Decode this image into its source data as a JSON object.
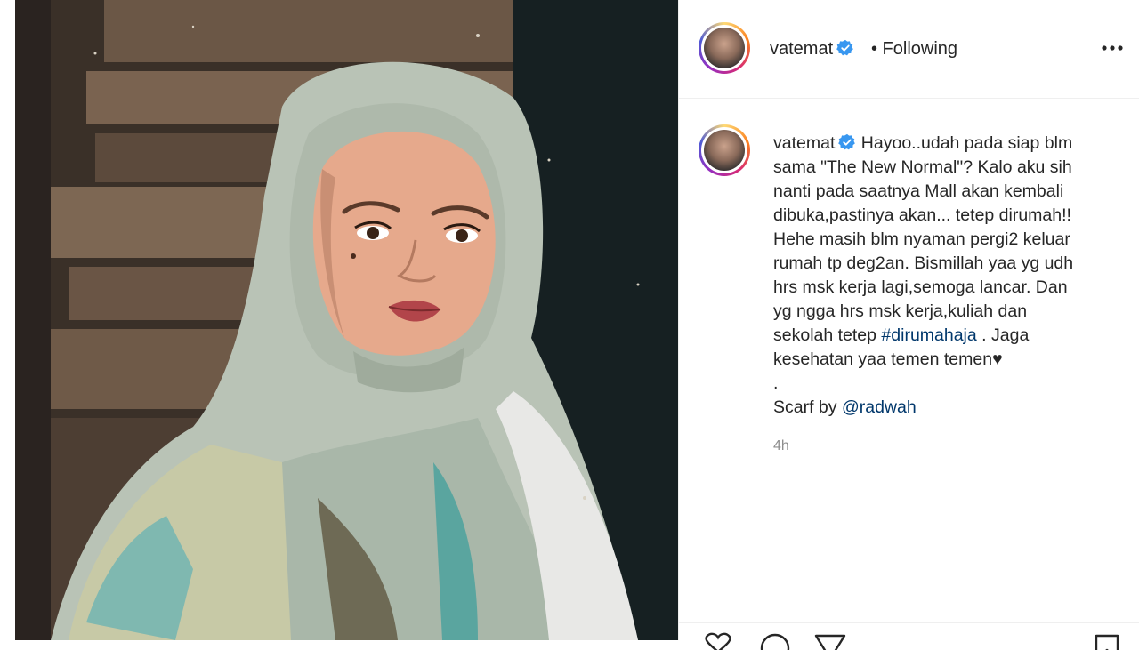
{
  "post": {
    "username": "vatemat",
    "following_label": "• Following",
    "caption_lines": [
      "Hayoo..udah pada siap blm",
      "sama \"The New Normal\"? Kalo aku sih",
      "nanti pada saatnya Mall akan kembali",
      "dibuka,pastinya akan... tetep dirumah!!",
      "Hehe masih blm nyaman pergi2 keluar",
      "rumah tp deg2an. Bismillah yaa yg udh",
      "hrs msk kerja lagi,semoga lancar. Dan",
      "yg ngga hrs msk kerja,kuliah dan"
    ],
    "caption_line9_pre": "sekolah tetep ",
    "hashtag": "#dirumahaja",
    "caption_line9_post": " . Jaga",
    "caption_line10": "kesehatan yaa temen temen♥",
    "caption_dot": ".",
    "scarf_pre": "Scarf by ",
    "mention": "@radwah",
    "time_ago": "4h"
  },
  "icons": {
    "verified": "verified-badge-icon",
    "more": "more-options-icon",
    "heart": "heart-icon",
    "comment": "comment-icon",
    "share": "share-icon",
    "save": "save-icon"
  },
  "colors": {
    "verified_blue": "#3897f0",
    "link_blue": "#00376b",
    "meta_gray": "#8e8e8e"
  }
}
